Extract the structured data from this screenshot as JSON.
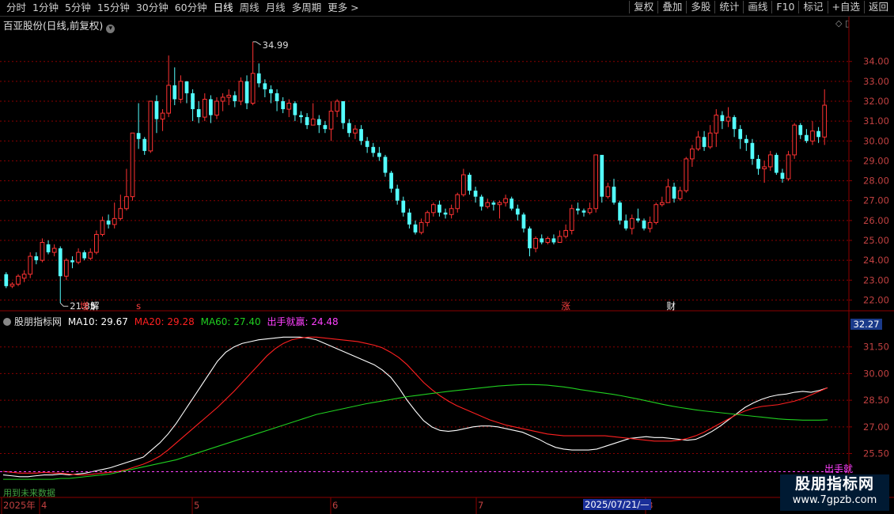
{
  "toolbar": {
    "periods": [
      "分时",
      "1分钟",
      "5分钟",
      "15分钟",
      "30分钟",
      "60分钟",
      "日线",
      "周线",
      "月线",
      "多周期",
      "更多 >"
    ],
    "active_period": "日线",
    "actions": [
      "复权",
      "叠加",
      "多股",
      "统计",
      "画线",
      "F10",
      "标记",
      "+自选",
      "返回"
    ]
  },
  "stock": {
    "title": "百亚股份(日线,前复权)"
  },
  "annotations": {
    "high_label": "34.99",
    "low_label": "21.85"
  },
  "event_markers": [
    {
      "label": "增",
      "color": "#ff4040"
    },
    {
      "label": "解",
      "color": "#ffffff"
    },
    {
      "label": "s",
      "color": "#ff4040"
    },
    {
      "label": "涨",
      "color": "#ff4040"
    },
    {
      "label": "财",
      "color": "#ffffff"
    }
  ],
  "indicator": {
    "name": "股朋指标网",
    "ma10": "MA10: 29.67",
    "ma20": "MA20: 29.28",
    "ma60": "MA60: 27.40",
    "chujiu": "出手就赢: 24.48",
    "chujiu_tag": "出手就",
    "last_price": "32.27",
    "bottom_text": "用到未来数据"
  },
  "x_axis": {
    "labels": [
      "2025年",
      "4",
      "5",
      "6",
      "7",
      "8"
    ],
    "date_tag": "2025/07/21/—"
  },
  "watermark": {
    "line1": "股朋指标网",
    "line2": "www.7gpzb.com"
  },
  "colors": {
    "up": "#ff3232",
    "down": "#54ffff",
    "ma10": "#ffffff",
    "ma20": "#ff2020",
    "ma60": "#20d020",
    "chujiu": "#ff40ff",
    "grid": "#8b0000"
  },
  "chart_data": [
    {
      "type": "candlestick",
      "title": "百亚股份(日线,前复权)",
      "ylim": [
        21.5,
        35.5
      ],
      "yticks": [
        22,
        23,
        24,
        25,
        26,
        27,
        28,
        29,
        30,
        31,
        32,
        33,
        34
      ],
      "ytick_labels": [
        "22.00",
        "23.00",
        "24.00",
        "25.00",
        "26.00",
        "27.00",
        "28.00",
        "29.00",
        "30.00",
        "31.00",
        "32.00",
        "33.00",
        "34.00"
      ],
      "candles": [
        [
          23.3,
          22.7,
          23.4,
          22.6
        ],
        [
          22.7,
          22.8,
          22.9,
          22.6
        ],
        [
          22.8,
          23.2,
          23.3,
          22.7
        ],
        [
          23.1,
          23.3,
          23.5,
          22.9
        ],
        [
          23.3,
          24.2,
          24.4,
          23.1
        ],
        [
          24.2,
          24.0,
          24.4,
          23.8
        ],
        [
          24.0,
          24.9,
          25.1,
          23.9
        ],
        [
          24.8,
          24.4,
          25.0,
          24.3
        ],
        [
          24.4,
          24.6,
          24.8,
          24.2
        ],
        [
          24.6,
          23.2,
          24.7,
          21.85
        ],
        [
          23.2,
          24.0,
          24.1,
          23.0
        ],
        [
          24.0,
          23.9,
          24.2,
          23.6
        ],
        [
          23.9,
          24.4,
          24.6,
          23.8
        ],
        [
          24.4,
          24.1,
          24.5,
          24.0
        ],
        [
          24.1,
          24.4,
          24.6,
          24.0
        ],
        [
          24.4,
          25.3,
          25.5,
          24.3
        ],
        [
          25.3,
          26.0,
          26.2,
          25.2
        ],
        [
          26.0,
          25.8,
          26.3,
          25.6
        ],
        [
          25.8,
          26.1,
          26.9,
          25.6
        ],
        [
          26.1,
          26.6,
          27.3,
          26.0
        ],
        [
          26.6,
          27.2,
          28.6,
          26.5
        ],
        [
          27.2,
          30.4,
          30.4,
          27.0
        ],
        [
          30.4,
          30.1,
          31.9,
          29.6
        ],
        [
          30.1,
          29.5,
          30.2,
          29.3
        ],
        [
          29.5,
          32.0,
          32.0,
          29.4
        ],
        [
          32.0,
          31.1,
          32.3,
          30.4
        ],
        [
          31.1,
          31.4,
          31.6,
          30.5
        ],
        [
          31.4,
          32.8,
          34.3,
          31.2
        ],
        [
          32.8,
          32.1,
          33.7,
          31.8
        ],
        [
          32.1,
          33.0,
          33.3,
          31.9
        ],
        [
          33.0,
          32.4,
          33.0,
          31.9
        ],
        [
          32.4,
          31.6,
          32.6,
          31.0
        ],
        [
          31.6,
          31.2,
          32.0,
          30.9
        ],
        [
          31.2,
          32.1,
          32.4,
          31.0
        ],
        [
          32.1,
          31.3,
          32.3,
          30.9
        ],
        [
          31.3,
          32.0,
          32.2,
          31.1
        ],
        [
          32.0,
          32.2,
          32.4,
          31.5
        ],
        [
          32.2,
          32.3,
          32.6,
          31.8
        ],
        [
          32.3,
          32.0,
          32.5,
          31.7
        ],
        [
          32.0,
          33.0,
          33.2,
          31.8
        ],
        [
          33.0,
          31.9,
          33.3,
          31.6
        ],
        [
          31.9,
          33.4,
          34.99,
          31.8
        ],
        [
          33.4,
          32.9,
          33.9,
          32.7
        ],
        [
          32.9,
          32.6,
          33.1,
          32.2
        ],
        [
          32.6,
          32.4,
          32.8,
          31.9
        ],
        [
          32.4,
          32.0,
          32.6,
          31.5
        ],
        [
          32.0,
          31.6,
          32.2,
          31.4
        ],
        [
          31.6,
          31.9,
          32.1,
          31.2
        ],
        [
          31.9,
          31.3,
          32.0,
          31.0
        ],
        [
          31.3,
          31.2,
          31.5,
          30.9
        ],
        [
          31.2,
          30.8,
          31.4,
          30.6
        ],
        [
          30.8,
          31.1,
          31.9,
          30.8
        ],
        [
          31.1,
          30.8,
          31.3,
          30.4
        ],
        [
          30.8,
          30.6,
          31.0,
          30.4
        ],
        [
          30.6,
          31.5,
          32.0,
          30.0
        ],
        [
          31.5,
          32.0,
          32.1,
          31.2
        ],
        [
          32.0,
          30.9,
          32.0,
          30.6
        ],
        [
          30.9,
          30.4,
          31.1,
          30.2
        ],
        [
          30.4,
          30.6,
          30.8,
          30.1
        ],
        [
          30.6,
          30.0,
          30.8,
          29.8
        ],
        [
          30.0,
          29.7,
          30.2,
          29.4
        ],
        [
          29.7,
          29.4,
          29.9,
          29.2
        ],
        [
          29.4,
          29.2,
          29.7,
          29.0
        ],
        [
          29.2,
          28.4,
          29.3,
          28.2
        ],
        [
          28.4,
          27.6,
          28.5,
          27.4
        ],
        [
          27.6,
          27.0,
          27.8,
          26.8
        ],
        [
          27.0,
          26.4,
          27.2,
          26.2
        ],
        [
          26.4,
          25.8,
          26.6,
          25.6
        ],
        [
          25.8,
          25.4,
          26.0,
          25.3
        ],
        [
          25.4,
          25.9,
          26.1,
          25.3
        ],
        [
          25.9,
          26.4,
          26.5,
          25.7
        ],
        [
          26.4,
          26.8,
          26.9,
          26.2
        ],
        [
          26.8,
          26.4,
          27.0,
          26.2
        ],
        [
          26.4,
          26.3,
          26.6,
          26.1
        ],
        [
          26.3,
          26.6,
          26.8,
          26.1
        ],
        [
          26.6,
          27.3,
          27.4,
          26.4
        ],
        [
          27.3,
          28.3,
          28.6,
          27.2
        ],
        [
          28.3,
          27.5,
          28.4,
          27.3
        ],
        [
          27.5,
          27.2,
          27.7,
          26.9
        ],
        [
          27.2,
          26.7,
          27.3,
          26.5
        ],
        [
          26.7,
          26.9,
          27.1,
          26.6
        ],
        [
          26.9,
          26.8,
          27.0,
          26.5
        ],
        [
          26.8,
          26.9,
          27.0,
          26.1
        ],
        [
          26.9,
          27.1,
          27.3,
          26.7
        ],
        [
          27.1,
          26.6,
          27.2,
          26.5
        ],
        [
          26.6,
          26.3,
          26.8,
          26.0
        ],
        [
          26.3,
          25.6,
          26.4,
          25.4
        ],
        [
          25.6,
          24.6,
          25.7,
          24.2
        ],
        [
          24.6,
          25.1,
          25.2,
          24.4
        ],
        [
          25.1,
          24.9,
          25.3,
          24.8
        ],
        [
          24.9,
          25.1,
          25.2,
          24.8
        ],
        [
          25.1,
          24.9,
          25.3,
          24.8
        ],
        [
          24.9,
          25.2,
          25.5,
          24.9
        ],
        [
          25.2,
          25.5,
          25.8,
          25.1
        ],
        [
          25.5,
          26.6,
          26.8,
          25.3
        ],
        [
          26.6,
          26.5,
          26.9,
          26.3
        ],
        [
          26.5,
          26.4,
          26.6,
          26.2
        ],
        [
          26.4,
          26.6,
          26.9,
          26.3
        ],
        [
          26.6,
          29.3,
          29.3,
          26.4
        ],
        [
          29.3,
          27.2,
          27.6,
          26.9
        ],
        [
          27.2,
          27.7,
          27.9,
          27.1
        ],
        [
          27.7,
          26.9,
          28.1,
          26.8
        ],
        [
          26.9,
          26.0,
          27.0,
          25.8
        ],
        [
          26.0,
          25.6,
          26.3,
          25.5
        ],
        [
          25.6,
          26.1,
          26.3,
          25.3
        ],
        [
          26.1,
          26.0,
          26.6,
          25.9
        ],
        [
          26.0,
          25.6,
          26.1,
          25.5
        ],
        [
          25.6,
          25.9,
          26.2,
          25.4
        ],
        [
          25.9,
          26.8,
          26.9,
          25.8
        ],
        [
          26.8,
          26.9,
          27.2,
          26.7
        ],
        [
          26.9,
          27.7,
          28.1,
          27.1
        ],
        [
          27.7,
          27.1,
          27.9,
          26.9
        ],
        [
          27.1,
          27.5,
          27.7,
          27.0
        ],
        [
          27.5,
          29.1,
          29.2,
          27.4
        ],
        [
          29.1,
          29.6,
          29.8,
          28.7
        ],
        [
          29.6,
          30.2,
          30.5,
          29.5
        ],
        [
          30.2,
          29.7,
          30.5,
          29.5
        ],
        [
          29.7,
          30.4,
          30.8,
          29.6
        ],
        [
          30.4,
          31.3,
          31.6,
          29.7
        ],
        [
          31.3,
          31.0,
          31.5,
          30.6
        ],
        [
          31.0,
          31.2,
          31.7,
          30.7
        ],
        [
          31.2,
          30.6,
          31.3,
          30.2
        ],
        [
          30.6,
          30.1,
          30.8,
          29.6
        ],
        [
          30.1,
          29.9,
          30.3,
          29.5
        ],
        [
          29.9,
          29.1,
          30.1,
          28.8
        ],
        [
          29.1,
          28.6,
          29.3,
          28.3
        ],
        [
          28.6,
          28.7,
          29.0,
          27.9
        ],
        [
          28.7,
          29.3,
          29.5,
          28.5
        ],
        [
          29.3,
          28.4,
          29.4,
          28.3
        ],
        [
          28.4,
          28.1,
          28.6,
          27.9
        ],
        [
          28.1,
          29.3,
          29.5,
          28.0
        ],
        [
          29.3,
          30.8,
          30.9,
          29.1
        ],
        [
          30.8,
          30.3,
          30.9,
          30.1
        ],
        [
          30.3,
          30.0,
          30.6,
          29.9
        ],
        [
          30.0,
          30.5,
          31.0,
          29.8
        ],
        [
          30.5,
          30.2,
          30.7,
          29.9
        ],
        [
          30.2,
          31.8,
          32.6,
          29.8
        ]
      ]
    },
    {
      "type": "line",
      "title": "股朋指标网",
      "ylim": [
        23.7,
        32.6
      ],
      "yticks": [
        25.5,
        27.0,
        28.5,
        30.0,
        31.5
      ],
      "ytick_labels": [
        "25.50",
        "27.00",
        "28.50",
        "30.00",
        "31.50"
      ],
      "series": [
        {
          "name": "MA10",
          "color": "#ffffff",
          "values": [
            24.3,
            24.25,
            24.2,
            24.2,
            24.25,
            24.3,
            24.3,
            24.35,
            24.3,
            24.35,
            24.4,
            24.5,
            24.6,
            24.7,
            24.85,
            25.0,
            25.15,
            25.3,
            25.7,
            26.1,
            26.6,
            27.2,
            27.9,
            28.6,
            29.3,
            30.0,
            30.7,
            31.2,
            31.5,
            31.7,
            31.8,
            31.9,
            31.95,
            32.0,
            32.05,
            32.05,
            32.05,
            32.0,
            31.9,
            31.7,
            31.5,
            31.3,
            31.1,
            30.9,
            30.7,
            30.5,
            30.2,
            29.8,
            29.2,
            28.5,
            27.9,
            27.35,
            27.0,
            26.8,
            26.75,
            26.8,
            26.9,
            27.0,
            27.05,
            27.05,
            27.0,
            26.9,
            26.8,
            26.7,
            26.5,
            26.3,
            26.05,
            25.85,
            25.75,
            25.7,
            25.7,
            25.7,
            25.75,
            25.9,
            26.05,
            26.2,
            26.35,
            26.4,
            26.45,
            26.4,
            26.4,
            26.35,
            26.3,
            26.25,
            26.3,
            26.5,
            26.75,
            27.05,
            27.4,
            27.75,
            28.1,
            28.35,
            28.55,
            28.7,
            28.8,
            28.85,
            28.95,
            29.0,
            28.95,
            29.05,
            29.2
          ]
        },
        {
          "name": "MA20",
          "color": "#ff2020",
          "values": [
            24.5,
            24.45,
            24.4,
            24.4,
            24.4,
            24.45,
            24.4,
            24.4,
            24.35,
            24.3,
            24.3,
            24.35,
            24.4,
            24.45,
            24.5,
            24.6,
            24.75,
            24.9,
            25.1,
            25.35,
            25.7,
            26.1,
            26.5,
            26.9,
            27.3,
            27.7,
            28.1,
            28.55,
            29.0,
            29.5,
            30.0,
            30.5,
            31.0,
            31.4,
            31.7,
            31.9,
            32.0,
            32.05,
            32.05,
            32.0,
            31.95,
            31.9,
            31.85,
            31.8,
            31.7,
            31.6,
            31.45,
            31.2,
            30.9,
            30.5,
            30.0,
            29.5,
            29.1,
            28.75,
            28.45,
            28.2,
            28.0,
            27.8,
            27.6,
            27.4,
            27.25,
            27.1,
            27.0,
            26.9,
            26.8,
            26.7,
            26.6,
            26.55,
            26.5,
            26.5,
            26.5,
            26.5,
            26.5,
            26.5,
            26.45,
            26.4,
            26.35,
            26.3,
            26.25,
            26.2,
            26.2,
            26.2,
            26.25,
            26.35,
            26.5,
            26.7,
            26.95,
            27.2,
            27.45,
            27.7,
            27.9,
            28.05,
            28.15,
            28.2,
            28.25,
            28.35,
            28.45,
            28.6,
            28.8,
            29.0,
            29.2
          ]
        },
        {
          "name": "MA60",
          "color": "#20d020",
          "values": [
            24.05,
            24.05,
            24.05,
            24.05,
            24.05,
            24.05,
            24.05,
            24.1,
            24.1,
            24.15,
            24.2,
            24.25,
            24.3,
            24.35,
            24.45,
            24.55,
            24.65,
            24.75,
            24.85,
            24.95,
            25.05,
            25.15,
            25.3,
            25.45,
            25.6,
            25.75,
            25.9,
            26.05,
            26.2,
            26.35,
            26.5,
            26.65,
            26.8,
            26.95,
            27.1,
            27.25,
            27.4,
            27.55,
            27.7,
            27.8,
            27.9,
            28.0,
            28.1,
            28.2,
            28.3,
            28.38,
            28.46,
            28.54,
            28.62,
            28.7,
            28.76,
            28.82,
            28.88,
            28.94,
            29.0,
            29.05,
            29.1,
            29.15,
            29.2,
            29.25,
            29.3,
            29.33,
            29.36,
            29.38,
            29.38,
            29.37,
            29.35,
            29.3,
            29.25,
            29.18,
            29.1,
            29.03,
            28.96,
            28.9,
            28.83,
            28.75,
            28.66,
            28.57,
            28.47,
            28.37,
            28.27,
            28.18,
            28.1,
            28.03,
            27.96,
            27.9,
            27.85,
            27.8,
            27.75,
            27.7,
            27.65,
            27.6,
            27.55,
            27.5,
            27.45,
            27.42,
            27.4,
            27.38,
            27.38,
            27.38,
            27.4
          ]
        },
        {
          "name": "出手就赢",
          "color": "#ff40ff",
          "values": [
            24.48
          ]
        }
      ]
    }
  ]
}
